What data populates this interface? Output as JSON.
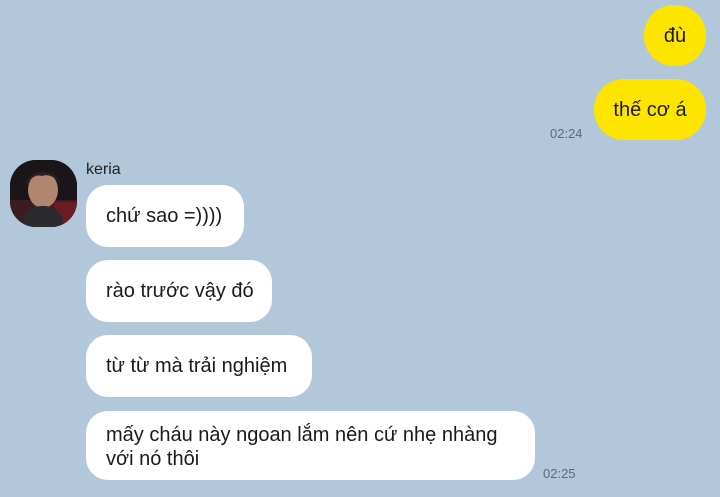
{
  "colors": {
    "background": "#b2c7da",
    "my_bubble": "#fee500",
    "their_bubble": "#ffffff"
  },
  "outgoing": [
    {
      "text": "đù"
    },
    {
      "text": "thế cơ á",
      "time": "02:24"
    }
  ],
  "incoming": {
    "sender": "keria",
    "avatar_icon": "profile-photo",
    "messages": [
      {
        "text": "chứ sao =))))"
      },
      {
        "text": "rào trước vậy đó"
      },
      {
        "text": "từ từ mà trải nghiệm"
      },
      {
        "text": "mấy cháu này ngoan lắm nên cứ nhẹ nhàng với nó thôi",
        "time": "02:25"
      }
    ]
  }
}
